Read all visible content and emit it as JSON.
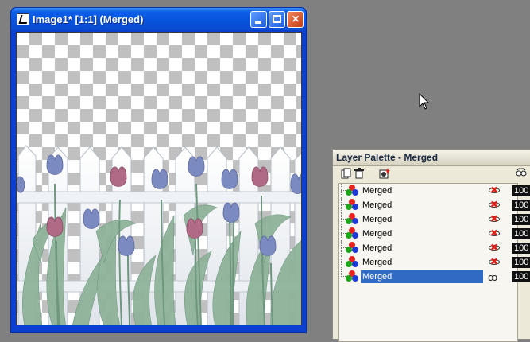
{
  "image_window": {
    "title": "Image1* [1:1] (Merged)",
    "buttons": {
      "minimize": "minimize",
      "maximize": "maximize",
      "close": "×"
    }
  },
  "layer_palette": {
    "title": "Layer Palette - Merged",
    "layers": [
      {
        "name": "Merged",
        "visible": false,
        "opacity": "100",
        "selected": false
      },
      {
        "name": "Merged",
        "visible": false,
        "opacity": "100",
        "selected": false
      },
      {
        "name": "Merged",
        "visible": false,
        "opacity": "100",
        "selected": false
      },
      {
        "name": "Merged",
        "visible": false,
        "opacity": "100",
        "selected": false
      },
      {
        "name": "Merged",
        "visible": false,
        "opacity": "100",
        "selected": false
      },
      {
        "name": "Merged",
        "visible": false,
        "opacity": "100",
        "selected": false
      },
      {
        "name": "Merged",
        "visible": true,
        "opacity": "100",
        "selected": true
      }
    ]
  },
  "colors": {
    "title_bar": "#0853dc",
    "desktop": "#808080",
    "selection": "#316ac5",
    "tulip_blue": "#7b8ac0",
    "tulip_pink": "#b06a86",
    "leaf": "#8fb39a"
  }
}
